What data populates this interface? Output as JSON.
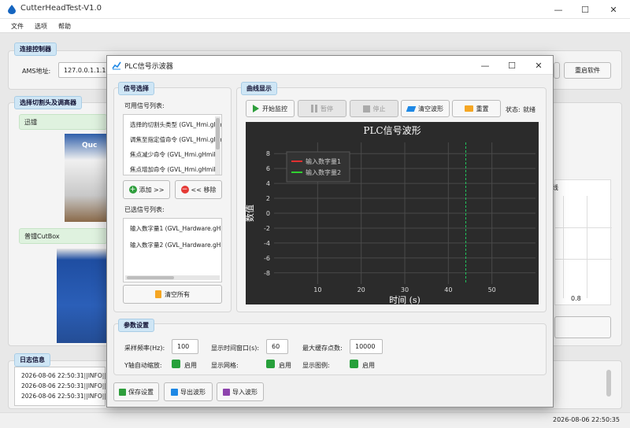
{
  "app": {
    "title": "CutterHeadTest-V1.0",
    "menu": [
      "文件",
      "选项",
      "帮助"
    ],
    "window_controls": {
      "minimize": "—",
      "maximize": "☐",
      "close": "✕"
    }
  },
  "connect": {
    "group_title": "连接控制器",
    "ams_label": "AMS地址:",
    "ams_value": "127.0.0.1.1.1",
    "restart_label": "重启软件"
  },
  "cutter_select": {
    "group_title": "选择切割头及调高器",
    "item1": "迅镭",
    "item2": "普镭CutBox"
  },
  "background_plot": {
    "title_fragment": "线",
    "tick_label": "0.8"
  },
  "log": {
    "group_title": "日志信息",
    "lines": [
      "2026-08-06 22:50:31||INFO||pl",
      "2026-08-06 22:50:31||INFO||m",
      "2026-08-06 22:50:31||INFO||m"
    ]
  },
  "status": {
    "time": "2026-08-06 22:50:35"
  },
  "dialog": {
    "title": "PLC信号示波器",
    "window_controls": {
      "minimize": "—",
      "maximize": "☐",
      "close": "✕"
    },
    "signal_select": {
      "group_title": "信号选择",
      "available_label": "可用信号列表:",
      "available": [
        "选择的切割头类型 (GVL_Hmi.gHmiF",
        "调焦至指定值命令 (GVL_Hmi.gHmiP",
        "焦点减少命令 (GVL_Hmi.gHmiP",
        "焦点增加命令 (GVL_Hmi.gHmiP"
      ],
      "add_label": "添加 >>",
      "remove_label": "<< 移除",
      "selected_label": "已选信号列表:",
      "selected": [
        "输入数字量1 (GVL_Hardware.gHa",
        "输入数字量2 (GVL_Hardware.gHa"
      ],
      "clear_label": "清空所有"
    },
    "curve": {
      "group_title": "曲线显示",
      "start_label": "开始监控",
      "pause_label": "暂停",
      "stop_label": "停止",
      "clear_label": "清空波形",
      "reset_label": "重置",
      "state_label": "状态:",
      "state_value": "就绪"
    },
    "params": {
      "group_title": "参数设置",
      "rate_label": "采样频率(Hz):",
      "rate_value": "100",
      "window_label": "显示时间窗口(s):",
      "window_value": "60",
      "buffer_label": "最大缓存点数:",
      "buffer_value": "10000",
      "yauto_label": "Y轴自动缩放:",
      "grid_label": "显示网格:",
      "legend_label": "显示图例:",
      "enable_label": "启用"
    },
    "actions": {
      "save_label": "保存设置",
      "export_label": "导出波形",
      "import_label": "导入波形"
    }
  },
  "chart_data": {
    "type": "line",
    "title": "PLC信号波形",
    "xlabel": "时间 (s)",
    "ylabel": "数值",
    "xlim": [
      0,
      60
    ],
    "ylim": [
      -9.5,
      9.5
    ],
    "xticks": [
      10,
      20,
      30,
      40,
      50
    ],
    "yticks": [
      -8,
      -6,
      -4,
      -2,
      0,
      2,
      4,
      6,
      8
    ],
    "grid": true,
    "legend_position": "top-left",
    "series": [
      {
        "name": "输入数字量1",
        "color": "#e03030",
        "values": []
      },
      {
        "name": "输入数字量2",
        "color": "#30d030",
        "values": []
      }
    ],
    "cursor_x": 44
  }
}
